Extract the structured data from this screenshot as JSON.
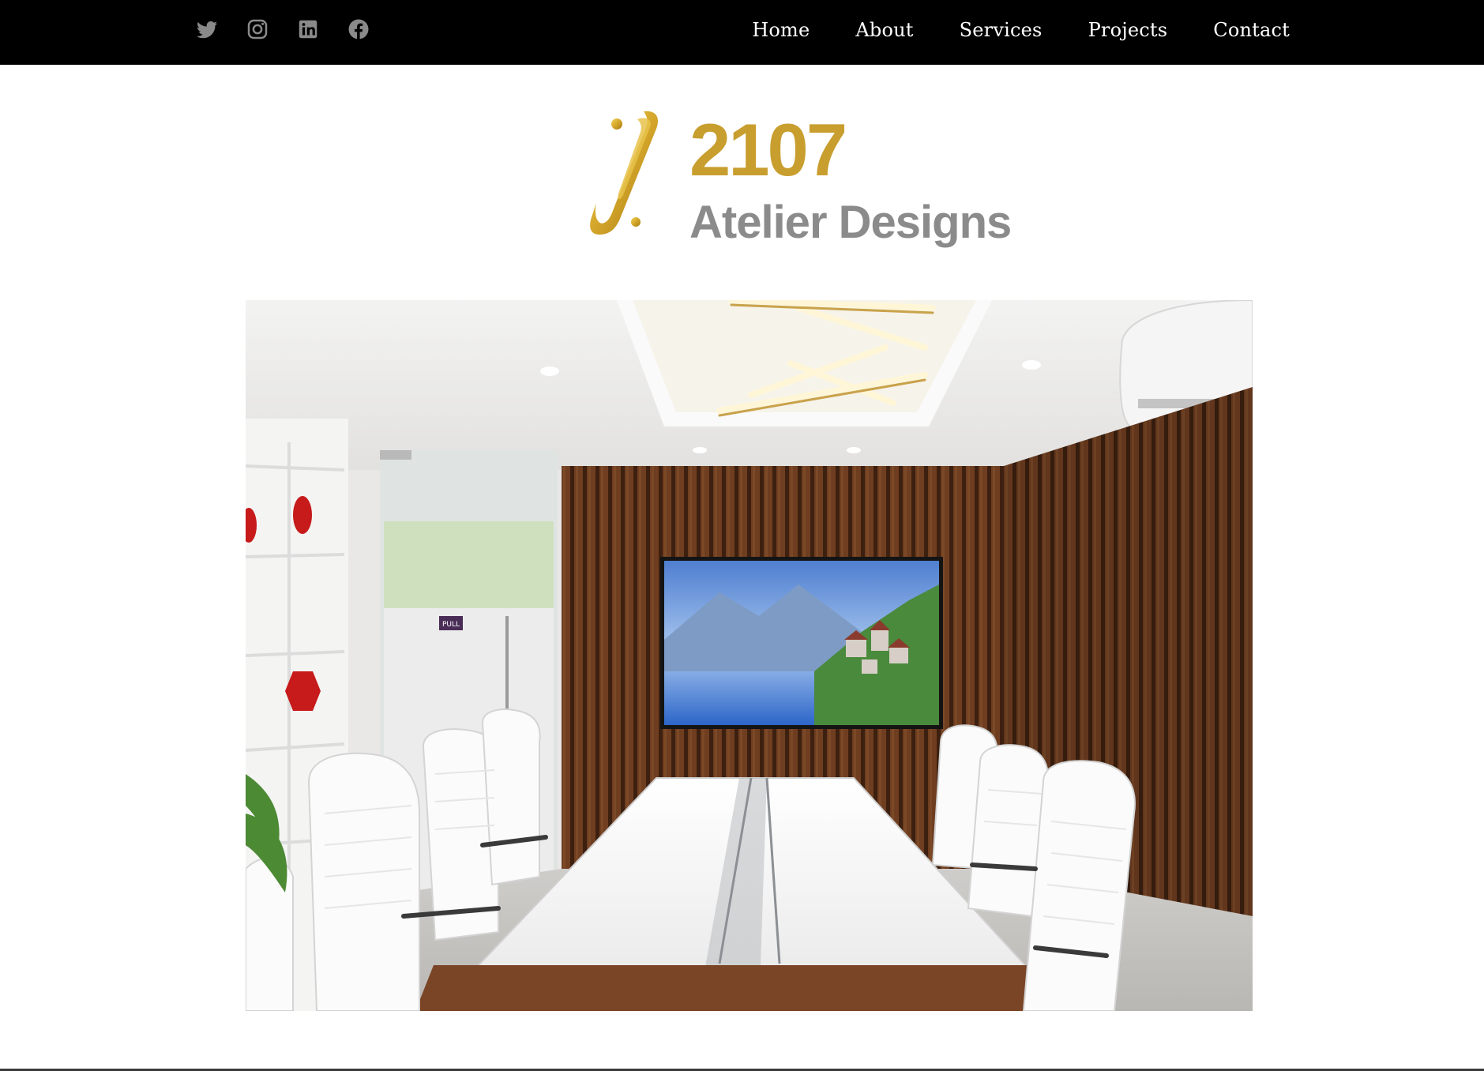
{
  "header": {
    "social_icons": [
      {
        "name": "twitter-icon"
      },
      {
        "name": "instagram-icon"
      },
      {
        "name": "linkedin-icon"
      },
      {
        "name": "facebook-icon"
      }
    ],
    "nav": [
      {
        "label": "Home"
      },
      {
        "label": "About"
      },
      {
        "label": "Services"
      },
      {
        "label": "Projects"
      },
      {
        "label": "Contact"
      }
    ]
  },
  "logo": {
    "number": "2107",
    "name": "Atelier Designs"
  },
  "hero": {
    "door_sign": "PULL"
  },
  "colors": {
    "topbar": "#000000",
    "social_icon": "#8a8a8a",
    "nav_text": "#ffffff",
    "brand_gold": "#c89e2e",
    "brand_gray": "#8b8b8b",
    "wood_panel": "#6e3f22"
  }
}
